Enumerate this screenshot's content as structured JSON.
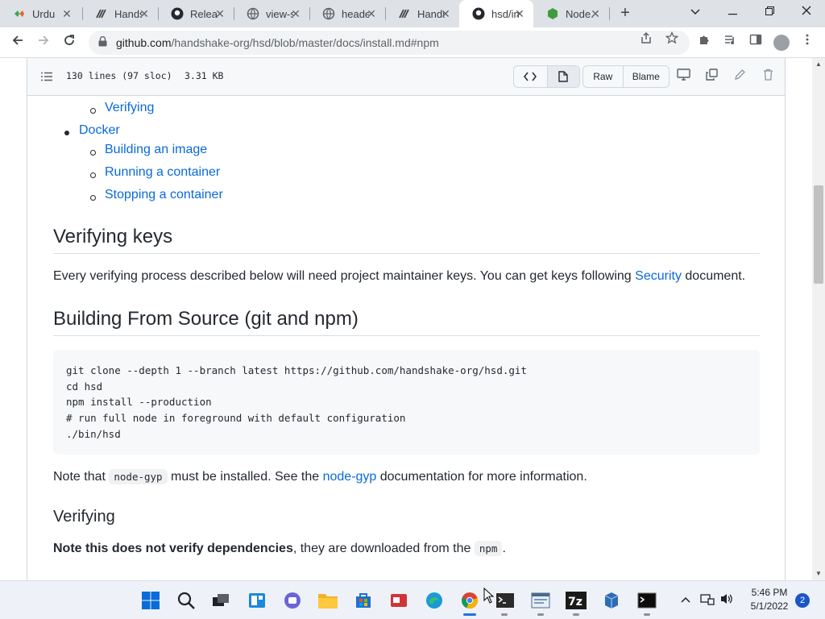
{
  "browser": {
    "tabs": [
      {
        "title": "Urdu",
        "icon": "urdu-favicon-icon"
      },
      {
        "title": "Handshake",
        "icon": "handshake-favicon-icon"
      },
      {
        "title": "Releases",
        "icon": "github-favicon-icon"
      },
      {
        "title": "view-source",
        "icon": "globe-favicon-icon"
      },
      {
        "title": "headers",
        "icon": "globe-favicon-icon"
      },
      {
        "title": "Handshake",
        "icon": "handshake-favicon-icon"
      },
      {
        "title": "hsd/install",
        "icon": "github-favicon-icon",
        "active": true
      },
      {
        "title": "Node.js",
        "icon": "nodejs-favicon-icon"
      }
    ],
    "url_domain": "github.com",
    "url_path": "/handshake-org/hsd/blob/master/docs/install.md#npm"
  },
  "file_header": {
    "lines": "130 lines (97 sloc)",
    "size": "3.31 KB",
    "raw_label": "Raw",
    "blame_label": "Blame"
  },
  "toc": {
    "verifying": "Verifying",
    "docker": "Docker",
    "building_image": "Building an image",
    "running_container": "Running a container",
    "stopping_container": "Stopping a container"
  },
  "sections": {
    "verifying_keys_heading": "Verifying keys",
    "verifying_keys_text": "Every verifying process described below will need project maintainer keys. You can get keys following ",
    "security_link": "Security",
    "verifying_keys_text_end": " document.",
    "building_heading": "Building From Source (git and npm)",
    "code_lines": [
      "git clone --depth 1 --branch latest https://github.com/handshake-org/hsd.git",
      "cd hsd",
      "npm install --production",
      "# run full node in foreground with default configuration",
      "./bin/hsd"
    ],
    "note_prefix": "Note that ",
    "note_code": "node-gyp",
    "note_middle": " must be installed. See the ",
    "note_link": "node-gyp",
    "note_suffix": " documentation for more information.",
    "verifying_heading": "Verifying",
    "verify_note_bold": "Note this does not verify dependencies",
    "verify_note_text": ", they are downloaded from the ",
    "verify_note_code": "npm",
    "verify_note_end": "."
  },
  "taskbar": {
    "time": "5:46 PM",
    "date": "5/1/2022",
    "notifications": "2"
  }
}
